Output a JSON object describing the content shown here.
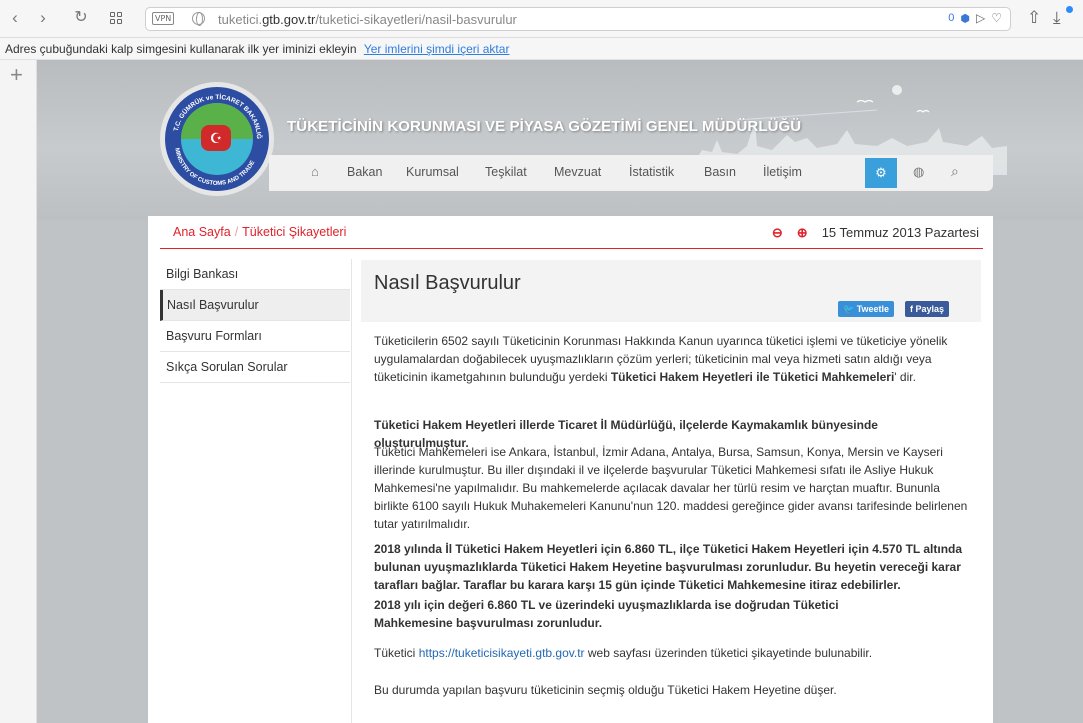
{
  "browser": {
    "vpn_label": "VPN",
    "url_host": "tuketici.",
    "url_domain": "gtb.gov.tr",
    "url_path": "/tuketici-sikayetleri/nasil-basvurulur",
    "shield_count": "0",
    "bookmark_hint": "Adres çubuğundaki kalp simgesini kullanarak ilk yer iminizi ekleyin",
    "bookmark_link": "Yer imlerini şimdi içeri aktar"
  },
  "site": {
    "title": "TÜKETİCİNİN KORUNMASI VE PİYASA GÖZETİMİ GENEL MÜDÜRLÜĞÜ",
    "logo_top_text": "T.C. GÜMRÜK ve TİCARET BAKANLIĞI",
    "logo_bottom_text": "MINISTRY OF CUSTOMS AND TRADE",
    "nav": [
      "Bakan",
      "Kurumsal",
      "Teşkilat",
      "Mevzuat",
      "İstatistik",
      "Basın",
      "İletişim"
    ]
  },
  "breadcrumb": {
    "home": "Ana Sayfa",
    "current": "Tüketici Şikayetleri",
    "date": "15 Temmuz 2013 Pazartesi"
  },
  "sidebar": {
    "items": [
      "Bilgi Bankası",
      "Nasıl Başvurulur",
      "Başvuru Formları",
      "Sıkça Sorulan Sorular"
    ]
  },
  "article": {
    "title": "Nasıl Başvurulur",
    "tweet_label": "Tweetle",
    "share_label": "Paylaş",
    "p1_text": "Tüketicilerin 6502 sayılı Tüketicinin Korunması Hakkında Kanun uyarınca tüketici işlemi ve tüketiciye yönelik uygulamalardan doğabilecek uyuşmazlıkların çözüm yerleri; tüketicinin mal veya hizmeti satın aldığı veya tüketicinin ikametgahının bulunduğu yerdeki ",
    "p1_bold": "Tüketici Hakem Heyetleri ile Tüketici Mahkemeleri",
    "p1_end": "' dir.",
    "p2": "Tüketici Hakem Heyetleri illerde Ticaret İl Müdürlüğü, ilçelerde Kaymakamlık bünyesinde oluşturulmuştur.",
    "p3": "Tüketici Mahkemeleri ise Ankara, İstanbul, İzmir Adana, Antalya, Bursa, Samsun, Konya, Mersin ve Kayseri illerinde kurulmuştur. Bu iller dışındaki il ve ilçelerde başvurular Tüketici Mahkemesi sıfatı ile Asliye Hukuk Mahkemesi'ne yapılmalıdır. Bu mahkemelerde açılacak davalar her türlü resim ve harçtan muaftır. Bununla birlikte 6100 sayılı Hukuk Muhakemeleri Kanunu'nun 120. maddesi gereğince gider avansı tarifesinde belirlenen tutar yatırılmalıdır.",
    "p4": "2018 yılında İl Tüketici Hakem Heyetleri için 6.860 TL, ilçe Tüketici Hakem Heyetleri için 4.570 TL altında bulunan uyuşmazlıklarda Tüketici Hakem Heyetine başvurulması zorunludur. Bu heyetin vereceği karar tarafları bağlar. Taraflar bu karara karşı 15 gün içinde Tüketici Mahkemesine itiraz edebilirler.",
    "p5": "2018 yılı için değeri 6.860 TL ve üzerindeki uyuşmazlıklarda ise doğrudan Tüketici Mahkemesine başvurulması zorunludur.",
    "p6_before": "Tüketici  ",
    "p6_link": "https://tuketicisikayeti.gtb.gov.tr",
    "p6_after": " web sayfası üzerinden tüketici şikayetinde bulunabilir.",
    "p7": "Bu durumda yapılan başvuru tüketicinin  seçmiş olduğu Tüketici Hakem Heyetine düşer."
  },
  "colors": {
    "accent_red": "#e0222b",
    "nav_blue": "#3aa0db",
    "twitter": "#3a8fd9",
    "facebook": "#3b5a9a"
  }
}
